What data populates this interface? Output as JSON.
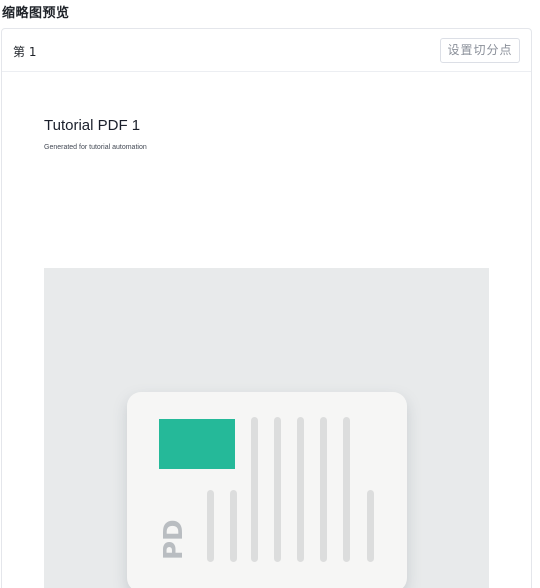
{
  "section": {
    "title": "缩略图预览"
  },
  "page_card": {
    "page_label": "第 1",
    "split_button_label": "设置切分点"
  },
  "preview": {
    "doc_title": "Tutorial PDF 1",
    "doc_subtitle": "Generated for tutorial automation",
    "image": {
      "icon_text": "PD",
      "accent_color": "#25b999"
    }
  }
}
